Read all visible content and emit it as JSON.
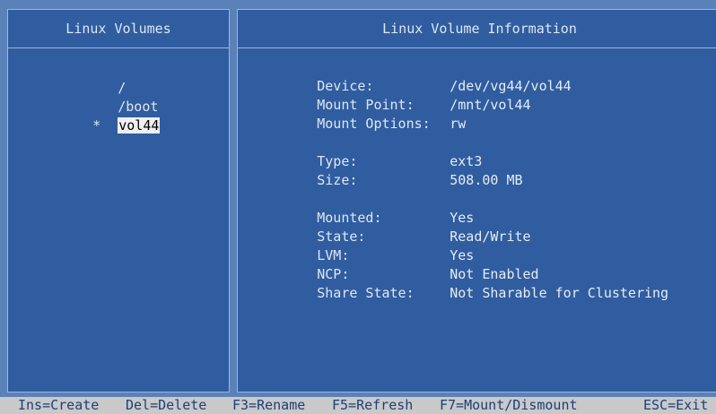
{
  "left_panel": {
    "title": "Linux Volumes",
    "items": [
      {
        "marker": "",
        "name": "/",
        "selected": false
      },
      {
        "marker": "",
        "name": "/boot",
        "selected": false
      },
      {
        "marker": "*",
        "name": "vol44",
        "selected": true
      }
    ]
  },
  "right_panel": {
    "title": "Linux Volume Information",
    "device_label": "Device:",
    "device_value": "/dev/vg44/vol44",
    "mount_point_label": "Mount Point:",
    "mount_point_value": "/mnt/vol44",
    "mount_options_label": "Mount Options:",
    "mount_options_value": "rw",
    "type_label": "Type:",
    "type_value": "ext3",
    "size_label": "Size:",
    "size_value": "508.00 MB",
    "mounted_label": "Mounted:",
    "mounted_value": "Yes",
    "state_label": "State:",
    "state_value": "Read/Write",
    "lvm_label": "LVM:",
    "lvm_value": "Yes",
    "ncp_label": "NCP:",
    "ncp_value": "Not Enabled",
    "share_state_label": "Share State:",
    "share_state_value": "Not Sharable for Clustering"
  },
  "statusbar": {
    "ins": "Ins=Create",
    "del": "Del=Delete",
    "f3": "F3=Rename",
    "f5": "F5=Refresh",
    "f7": "F7=Mount/Dismount",
    "esc": "ESC=Exit"
  },
  "colors": {
    "background": "#5a82b8",
    "panel": "#2f5da0",
    "statusbar": "#c9c9c9",
    "selection": "#f0f0f0"
  }
}
